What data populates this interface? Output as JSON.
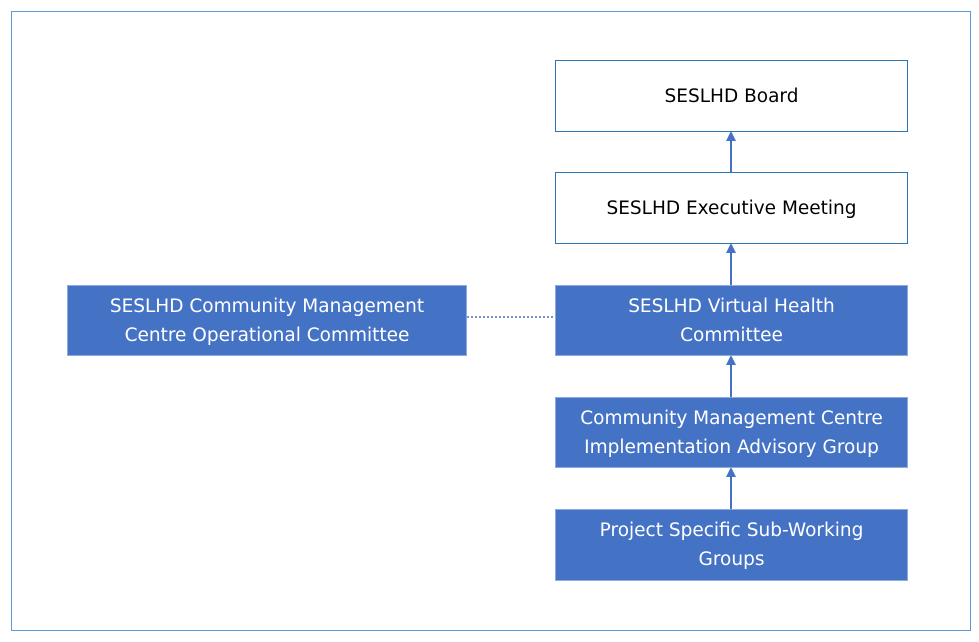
{
  "diagram": {
    "nodes": {
      "board": {
        "label": "SESLHD Board"
      },
      "executive": {
        "label": "SESLHD Executive Meeting"
      },
      "virtual_health": {
        "label": "SESLHD Virtual Health Committee"
      },
      "advisory_group": {
        "label": "Community Management Centre Implementation Advisory Group"
      },
      "sub_working": {
        "label": "Project Specific Sub-Working Groups"
      },
      "operational": {
        "label": "SESLHD Community Management Centre Operational Committee"
      }
    },
    "edges": [
      {
        "from": "executive",
        "to": "board",
        "style": "solid-arrow"
      },
      {
        "from": "virtual_health",
        "to": "executive",
        "style": "solid-arrow"
      },
      {
        "from": "advisory_group",
        "to": "virtual_health",
        "style": "solid-arrow"
      },
      {
        "from": "sub_working",
        "to": "advisory_group",
        "style": "solid-arrow"
      },
      {
        "from": "operational",
        "to": "virtual_health",
        "style": "dotted-line"
      }
    ],
    "colors": {
      "frame": "#5b9bd5",
      "white_box_border": "#2e74b5",
      "blue_box_fill": "#4472c4",
      "connector": "#4472c4"
    }
  }
}
